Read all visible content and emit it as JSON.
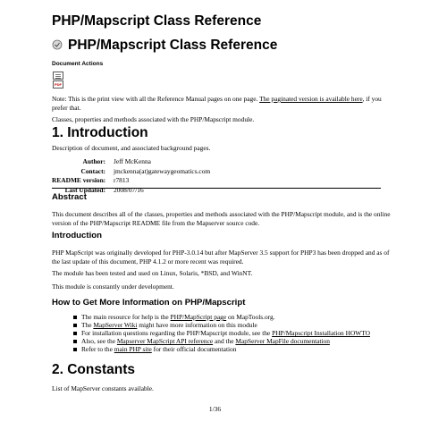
{
  "doc_title": "PHP/Mapscript Class Reference",
  "doc_heading": "PHP/Mapscript Class Reference",
  "document_actions": {
    "label": "Document Actions",
    "icons": [
      "print-icon",
      "pdf-icon"
    ],
    "pdf_tag": "PDF"
  },
  "note": {
    "prefix": "Note: This is the print view with all the Reference Manual pages on one page. ",
    "link": "The paginated version is available here",
    "suffix": ", if you prefer that."
  },
  "intro_text": "Classes, properties and methods associated with the PHP/Mapscript module.",
  "section1": {
    "title": "1. Introduction",
    "description": "Description of document, and associated background pages.",
    "meta": [
      {
        "label": "Author:",
        "value": "Jeff McKenna"
      },
      {
        "label": "Contact:",
        "value": "jmckenna(at)gatewaygeomatics.com"
      },
      {
        "label": "README version:",
        "value": "r7813"
      },
      {
        "label": "Last Updated:",
        "value": "2008/07/16"
      }
    ]
  },
  "abstract": {
    "title": "Abstract",
    "text": "This document describes all of the classes, properties and methods associated with the PHP/Mapscript module, and is the online version of the PHP/Mapscript README file from the Mapserver source code."
  },
  "introduction": {
    "title": "Introduction",
    "p1": "PHP MapScript was originally developed for PHP-3.0.14 but after MapServer 3.5 support for PHP3 has been dropped and as of the last update of this document, PHP 4.1.2 or more recent was required.",
    "p2": "The module has been tested and used on Linux, Solaris, *BSD, and WinNT.",
    "p3": "This module is constantly under development."
  },
  "more_info": {
    "title": "How to Get More Information on PHP/Mapscript",
    "items": [
      {
        "pre": "The main resource for help is the ",
        "link": "PHP/MapScript page",
        "post": " on MapTools.org."
      },
      {
        "pre": "The ",
        "link": "MapServer Wiki",
        "post": " might have more information on this module"
      },
      {
        "pre": "For installation questions regarding the PHP/Mapscript module, see the ",
        "link": "PHP/Mapscript Installation HOWTO",
        "post": ""
      },
      {
        "pre": "Also, see the ",
        "link": "Mapserver MapScript API reference",
        "post": " and the ",
        "link2": "MapServer MapFile documentation",
        "post2": ""
      },
      {
        "pre": "Refer to the ",
        "link": "main PHP site",
        "post": " for their official documentation"
      }
    ]
  },
  "section2": {
    "title": "2. Constants",
    "text": "List of MapServer constants available."
  },
  "page_number": "1/36"
}
